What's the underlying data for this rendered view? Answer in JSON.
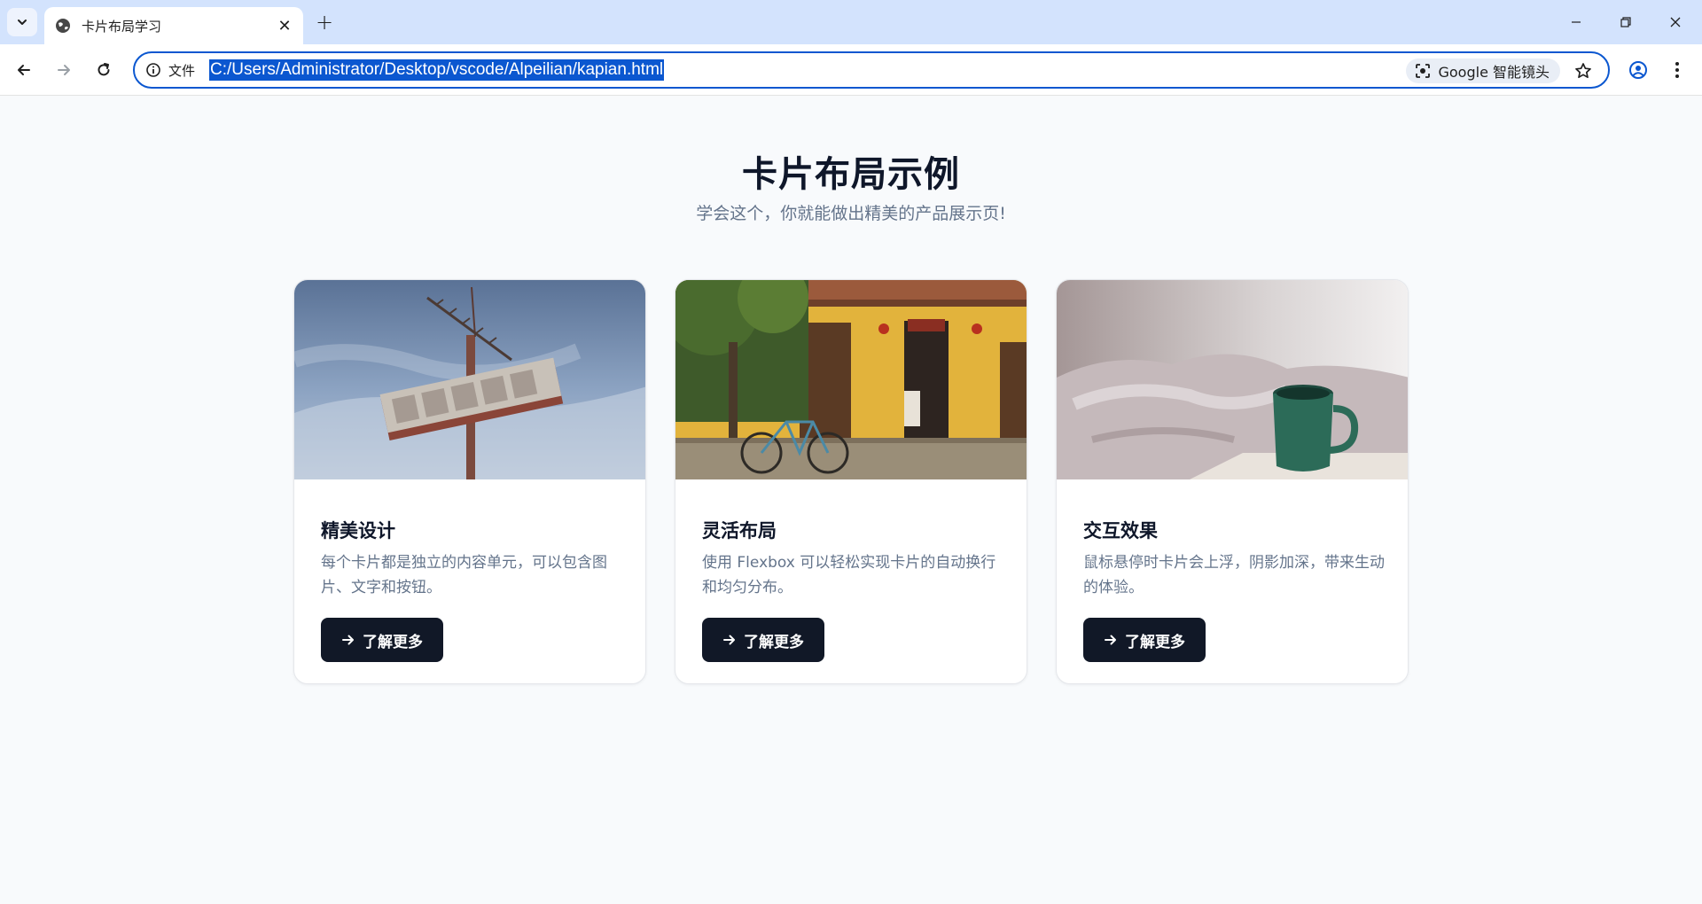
{
  "browser": {
    "tab_title": "卡片布局学习",
    "address_chip": "文件",
    "url": "C:/Users/Administrator/Desktop/vscode/Alpeilian/kapian.html",
    "lens_label": "Google 智能镜头"
  },
  "page": {
    "title": "卡片布局示例",
    "subtitle": "学会这个，你就能做出精美的产品展示页!"
  },
  "cards": [
    {
      "image": "motel-sign-photo",
      "title": "精美设计",
      "description": "每个卡片都是独立的内容单元，可以包含图片、文字和按钮。",
      "button_label": "了解更多"
    },
    {
      "image": "yellow-house-bicycle-photo",
      "title": "灵活布局",
      "description": "使用 Flexbox 可以轻松实现卡片的自动换行和均匀分布。",
      "button_label": "了解更多"
    },
    {
      "image": "coffee-mug-bed-photo",
      "title": "交互效果",
      "description": "鼠标悬停时卡片会上浮，阴影加深，带来生动的体验。",
      "button_label": "了解更多"
    }
  ],
  "colors": {
    "accent": "#0b57d0",
    "tabstrip": "#d3e3fd",
    "button": "#111827",
    "title": "#0f172a",
    "muted": "#64748b"
  }
}
